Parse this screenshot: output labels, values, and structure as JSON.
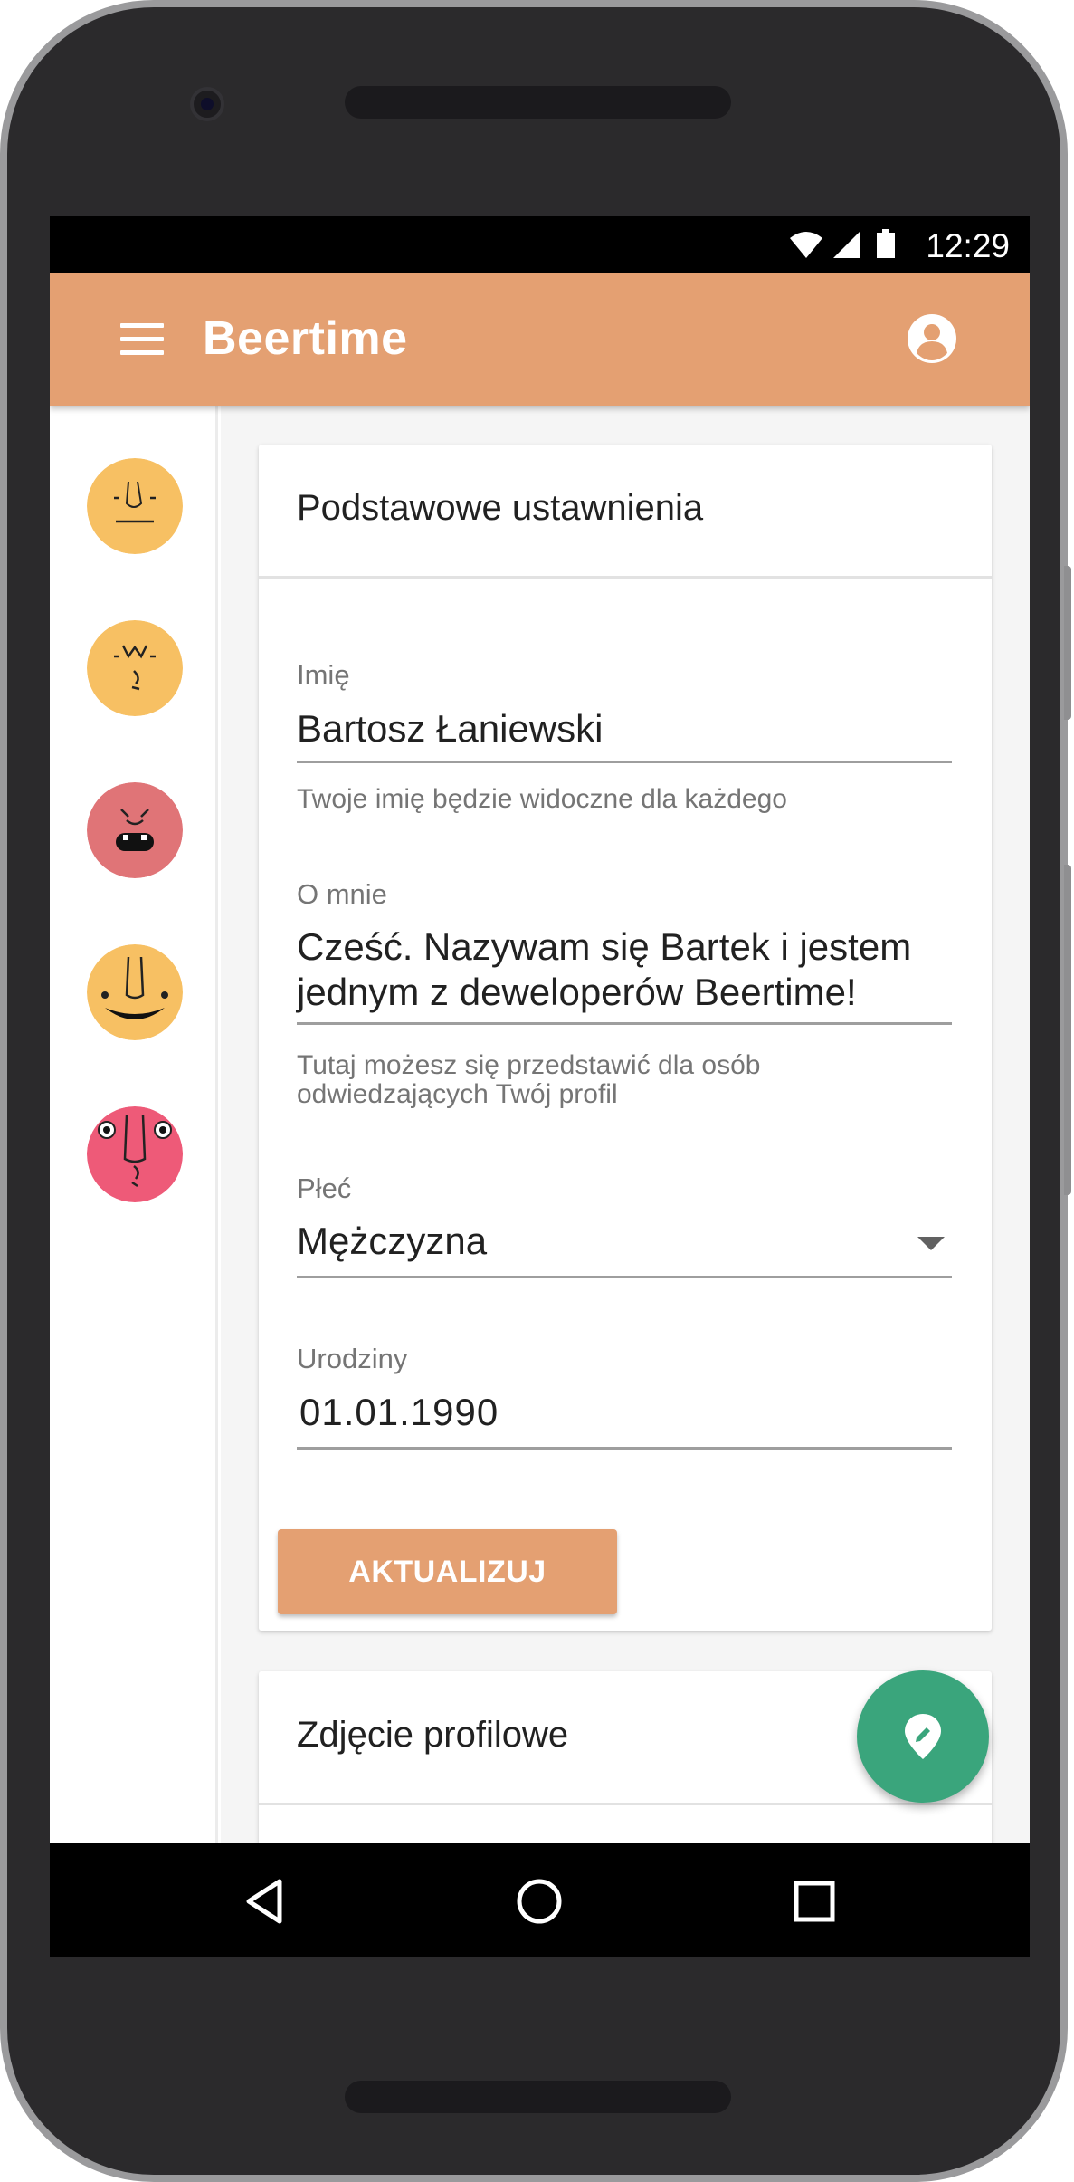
{
  "status_bar": {
    "time": "12:29"
  },
  "app_bar": {
    "title": "Beertime"
  },
  "sidebar": {
    "avatars": [
      {
        "name": "avatar-1",
        "color": "#f7c063"
      },
      {
        "name": "avatar-2",
        "color": "#f7c063"
      },
      {
        "name": "avatar-3",
        "color": "#e07477"
      },
      {
        "name": "avatar-4",
        "color": "#f7c063"
      },
      {
        "name": "avatar-5",
        "color": "#ee5a78"
      }
    ]
  },
  "basic_settings": {
    "title": "Podstawowe ustawnienia",
    "name": {
      "label": "Imię",
      "value": "Bartosz Łaniewski",
      "hint": "Twoje imię będzie widoczne dla każdego"
    },
    "about": {
      "label": "O mnie",
      "value": "Cześć. Nazywam się Bartek i jestem jednym z deweloperów Beertime!",
      "hint": "Tutaj możesz się przedstawić dla osób odwiedzających Twój profil"
    },
    "gender": {
      "label": "Płeć",
      "value": "Mężczyzna"
    },
    "birthday": {
      "label": "Urodziny",
      "value": "01.01.1990"
    },
    "update_button": "AKTUALIZUJ"
  },
  "profile_photo": {
    "title": "Zdjęcie profilowe"
  },
  "colors": {
    "accent": "#e4a072",
    "fab": "#3aa57c"
  },
  "icons": {
    "menu": "menu-icon",
    "account": "account-circle-icon",
    "fab": "location-pin-icon",
    "nav_back": "back-triangle-icon",
    "nav_home": "home-circle-icon",
    "nav_recents": "recents-square-icon"
  }
}
